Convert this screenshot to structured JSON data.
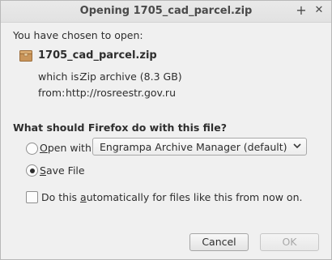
{
  "window": {
    "title": "Opening 1705_cad_parcel.zip",
    "plus_glyph": "+",
    "close_glyph": "✕"
  },
  "file": {
    "intro": "You have chosen to open:",
    "name": "1705_cad_parcel.zip",
    "which_is_label": "which is:",
    "which_is_value": "Zip archive (8.3 GB)",
    "from_label": "from:",
    "from_value": "http://rosreestr.gov.ru",
    "icon": "archive-icon"
  },
  "action": {
    "question": "What should Firefox do with this file?",
    "open_with_prefix": "",
    "open_with_mnemonic": "O",
    "open_with_rest": "pen with",
    "open_with_checked": false,
    "app_select_value": "Engrampa Archive Manager (default)",
    "save_mnemonic": "S",
    "save_rest": "ave File",
    "save_checked": true,
    "auto_prefix": "Do this ",
    "auto_mnemonic": "a",
    "auto_rest": "utomatically for files like this from now on.",
    "auto_checked": false
  },
  "buttons": {
    "cancel": "Cancel",
    "ok": "OK",
    "ok_enabled": false
  }
}
